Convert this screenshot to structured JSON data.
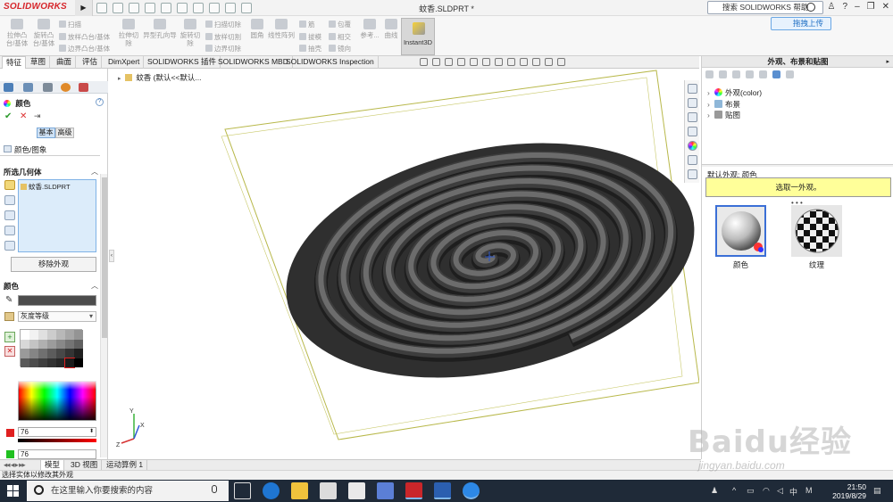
{
  "app": {
    "logo": "SOLIDWORKS",
    "document_title": "蚊香.SLDPRT *",
    "search_placeholder": "搜索 SOLIDWORKS 帮助",
    "upload_label": "拖拽上传"
  },
  "ribbon": {
    "extrude_boss": "拉伸凸\n台/基体",
    "revolve_boss": "旋转凸\n台/基体",
    "sweep": "扫描",
    "loft_boss": "放样凸台/基体",
    "boundary_boss": "边界凸台/基体",
    "extrude_cut": "拉伸切\n除",
    "hole_wizard": "异型孔向导",
    "revolve_cut": "旋转切\n除",
    "swept_cut": "扫描切除",
    "lofted_cut": "放样切割",
    "boundary_cut": "边界切除",
    "fillet": "圆角",
    "linear_pattern": "线性阵列",
    "rib": "筋",
    "draft": "拔模",
    "shell": "抽壳",
    "wrap": "包覆",
    "intersect": "相交",
    "mirror": "镜向",
    "reference": "参考...",
    "curves": "曲线",
    "instant3d": "Instant3D"
  },
  "tabs": [
    "特征",
    "草图",
    "曲面",
    "评估",
    "DimXpert",
    "SOLIDWORKS 插件",
    "SOLIDWORKS MBD",
    "SOLIDWORKS Inspection"
  ],
  "left_panel": {
    "title": "颜色",
    "mode_basic": "基本",
    "mode_advanced": "高级",
    "color_image_tab": "颜色/图象",
    "selected_geometry": "所选几何体",
    "geometry_item": "蚊香.SLDPRT",
    "remove_appearance": "移除外观",
    "color_section": "颜色",
    "palette": "灰度等级",
    "red_value": "76",
    "green_value": "76"
  },
  "viewport": {
    "tree_root": "蚊香 (默认<<默认..."
  },
  "right_panel": {
    "title": "外观、布景和贴图",
    "tree": [
      {
        "label": "外观(color)"
      },
      {
        "label": "布景"
      },
      {
        "label": "贴图"
      }
    ],
    "default_appearance": "默认外观: 颜色",
    "hint": "选取一外观。",
    "thumbs": [
      {
        "label": "颜色"
      },
      {
        "label": "纹理"
      }
    ]
  },
  "bottom_tabs": [
    "模型",
    "3D 视图",
    "运动算例 1"
  ],
  "status_text": "选择实体以修改其外观",
  "taskbar": {
    "search_placeholder": "在这里输入你要搜索的内容",
    "time": "21:50",
    "date": "2019/8/29",
    "ime": "M",
    "lang": "中"
  },
  "watermark": {
    "text": "Baidu经验",
    "url": "jingyan.baidu.com"
  },
  "colors": {
    "accent": "#1f6fc4",
    "logo_red": "#d6262b",
    "coil": "#4c4c4c"
  }
}
